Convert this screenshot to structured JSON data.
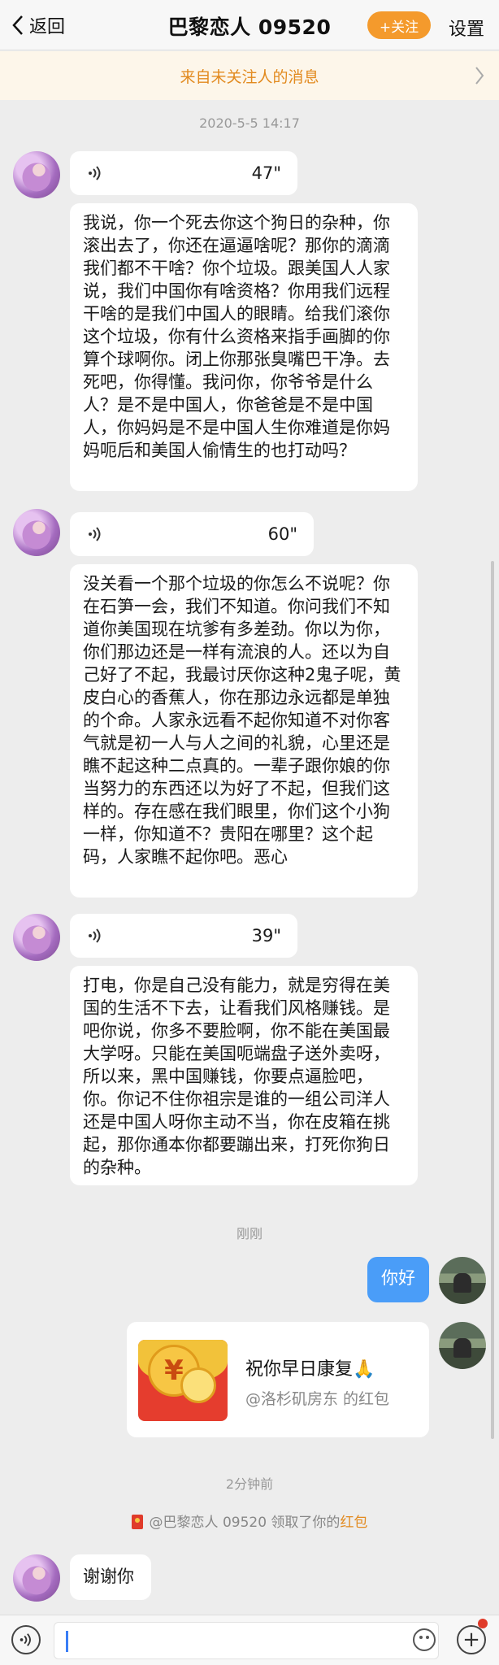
{
  "header": {
    "back_label": "返回",
    "title": "巴黎恋人 09520",
    "follow_label": "+关注",
    "settings_label": "设置"
  },
  "notice": {
    "text": "来自未关注人的消息"
  },
  "timestamps": {
    "first": "2020-5-5 14:17",
    "second": "刚刚",
    "third": "2分钟前"
  },
  "messages": {
    "voice1": {
      "duration": "47\""
    },
    "text1": "我说，你一个死去你这个狗日的杂种，你滚出去了，你还在逼逼啥呢？那你的滴滴我们都不干啥？你个垃圾。跟美国人人家说，我们中国你有啥资格？你用我们远程干啥的是我们中国人的眼睛。给我们滚你这个垃圾，你有什么资格来指手画脚的你算个球啊你。闭上你那张臭嘴巴干净。去死吧，你得懂。我问你，你爷爷是什么人？是不是中国人，你爸爸是不是中国人，你妈妈是不是中国人生你难道是你妈妈呃后和美国人偷情生的也打动吗？",
    "voice2": {
      "duration": "60\""
    },
    "text2": "没关看一个那个垃圾的你怎么不说呢？你在石笋一会，我们不知道。你问我们不知道你美国现在坑爹有多差劲。你以为你，你们那边还是一样有流浪的人。还以为自己好了不起，我最讨厌你这种2鬼子呢，黄皮白心的香蕉人，你在那边永远都是单独的个命。人家永远看不起你知道不对你客气就是初一人与人之间的礼貌，心里还是瞧不起这种二点真的。一辈子跟你娘的你当努力的东西还以为好了不起，但我们这样的。存在感在我们眼里，你们这个小狗一样，你知道不？贵阳在哪里？这个起码，人家瞧不起你吧。恶心",
    "voice3": {
      "duration": "39\""
    },
    "text3": "打电，你是自己没有能力，就是穷得在美国的生活不下去，让看我们风格赚钱。是吧你说，你多不要脸啊，你不能在美国最大学呀。只能在美国呃端盘子送外卖呀，所以来，黑中国赚钱，你要点逼脸吧，你。你记不住你祖宗是谁的一组公司洋人还是中国人呀你主动不当，你在皮箱在挑起，那你通本你都要蹦出来，打死你狗日的杂种。",
    "mine_text": "你好",
    "red_packet": {
      "title": "祝你早日康复🙏",
      "subtitle": "@洛杉矶房东 的红包",
      "icon_glyph": "¥"
    },
    "system": {
      "prefix": "@巴黎恋人 09520 领取了你的",
      "link": "红包"
    },
    "text4": "谢谢你"
  },
  "input": {
    "placeholder": ""
  },
  "colors": {
    "accent_orange": "#f49a2c",
    "bubble_blue": "#4a9df8",
    "notice_text": "#e28a1f"
  }
}
